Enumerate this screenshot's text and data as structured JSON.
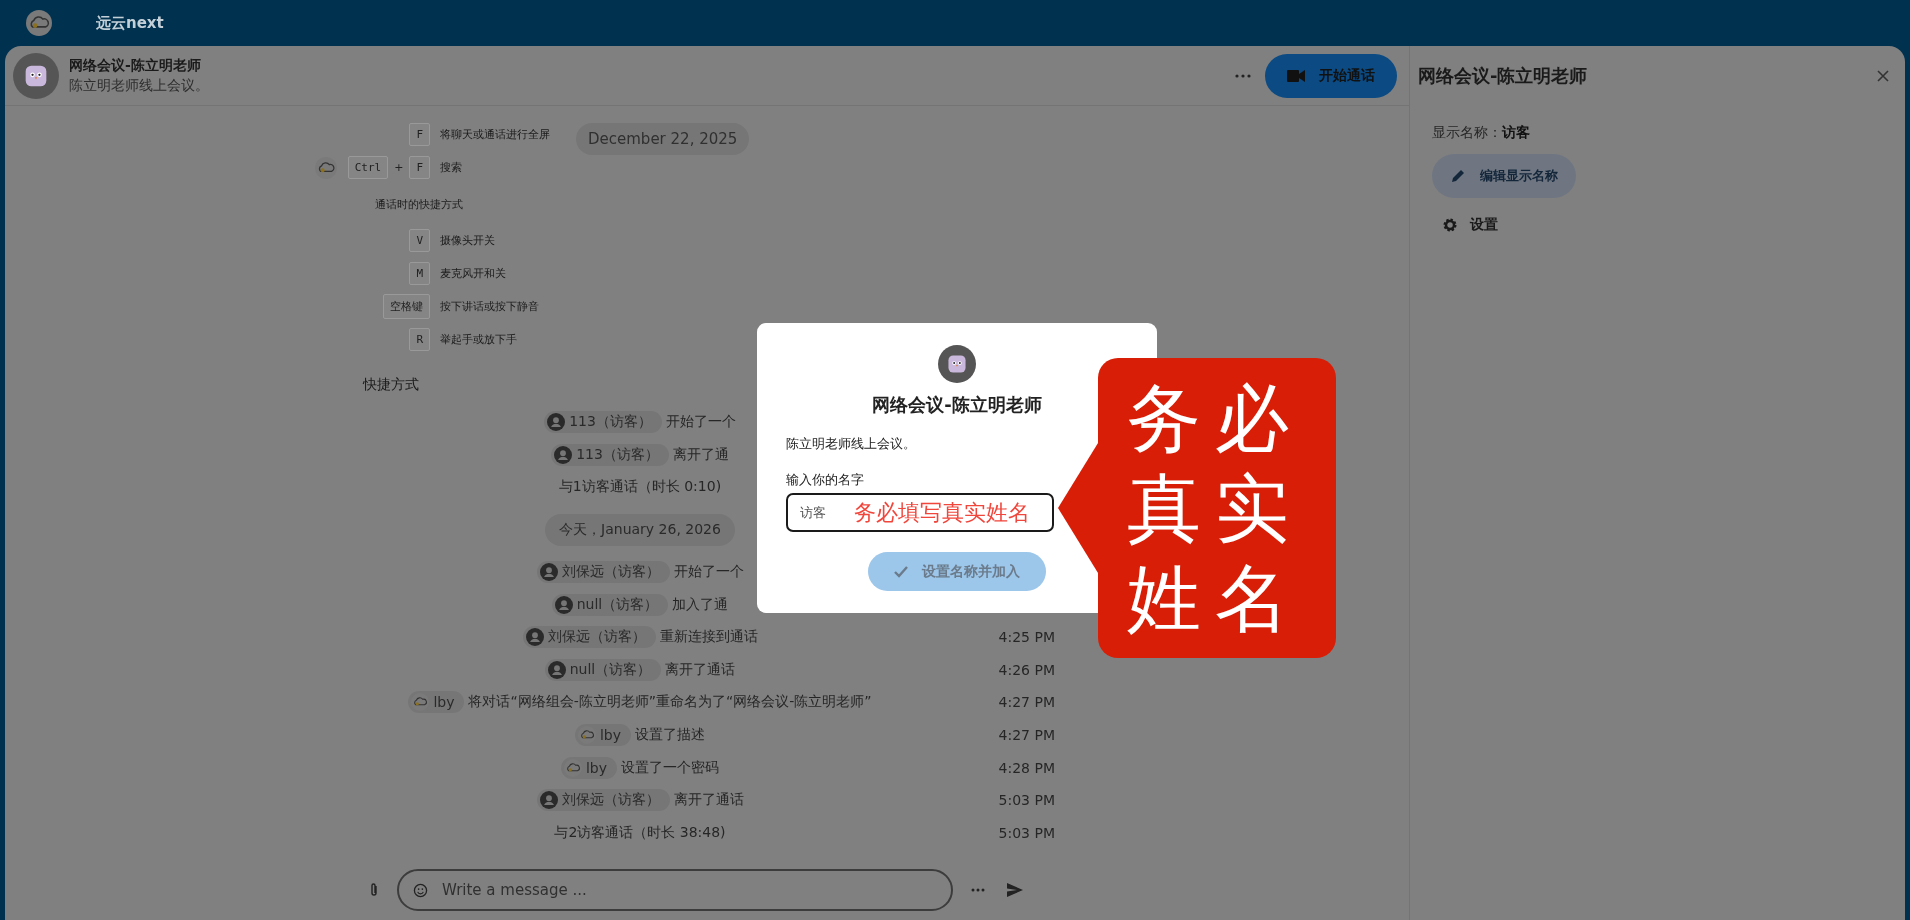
{
  "app": {
    "name": "远云next"
  },
  "conversation": {
    "title": "网络会议-陈立明老师",
    "description": "陈立明老师线上会议。",
    "start_call": "开始通话"
  },
  "shortcut_image": {
    "rows": [
      {
        "kind": "key",
        "keys": [
          "F"
        ],
        "text": "将聊天或通话进行全屏"
      },
      {
        "kind": "key",
        "keys": [
          "Ctrl",
          "F"
        ],
        "joiner": "+",
        "text": "搜索"
      },
      {
        "kind": "heading",
        "text": "通话时的快捷方式"
      },
      {
        "kind": "key",
        "keys": [
          "V"
        ],
        "text": "摄像头开关"
      },
      {
        "kind": "key",
        "keys": [
          "M"
        ],
        "text": "麦克风开和关"
      },
      {
        "kind": "key",
        "keys": [
          "空格键"
        ],
        "text": "按下讲话或按下静音"
      },
      {
        "kind": "key",
        "keys": [
          "R"
        ],
        "text": "举起手或放下手"
      }
    ]
  },
  "caption": "快捷方式",
  "sticky_date": "December 22, 2025",
  "messages": [
    {
      "kind": "event",
      "actor": {
        "name": "113（访客）",
        "kind": "person"
      },
      "text": "开始了一个"
    },
    {
      "kind": "event",
      "actor": {
        "name": "113（访客）",
        "kind": "person"
      },
      "text": "离开了通"
    },
    {
      "kind": "summary",
      "text": "与1访客通话（时长 0:10)"
    },
    {
      "kind": "date",
      "text": "今天，January 26, 2026"
    },
    {
      "kind": "event",
      "actor": {
        "name": "刘保远（访客）",
        "kind": "person"
      },
      "text": "开始了一个"
    },
    {
      "kind": "event",
      "actor": {
        "name": "null（访客）",
        "kind": "person"
      },
      "text": "加入了通"
    },
    {
      "kind": "event",
      "actor": {
        "name": "刘保远（访客）",
        "kind": "person"
      },
      "text": "重新连接到通话",
      "time": "4:25 PM"
    },
    {
      "kind": "event",
      "actor": {
        "name": "null（访客）",
        "kind": "person"
      },
      "text": "离开了通话",
      "time": "4:26 PM"
    },
    {
      "kind": "event",
      "actor": {
        "name": "lby",
        "kind": "logo"
      },
      "text": "将对话“网络组会-陈立明老师”重命名为了“网络会议-陈立明老师”",
      "time": "4:27 PM"
    },
    {
      "kind": "event",
      "actor": {
        "name": "lby",
        "kind": "logo"
      },
      "text": "设置了描述",
      "time": "4:27 PM"
    },
    {
      "kind": "event",
      "actor": {
        "name": "lby",
        "kind": "logo"
      },
      "text": "设置了一个密码",
      "time": "4:28 PM"
    },
    {
      "kind": "event",
      "actor": {
        "name": "刘保远（访客）",
        "kind": "person"
      },
      "text": "离开了通话",
      "time": "5:03 PM"
    },
    {
      "kind": "summary",
      "text": "与2访客通话（时长 38:48)",
      "time": "5:03 PM"
    }
  ],
  "composer": {
    "placeholder": "Write a message ..."
  },
  "sidebar": {
    "title": "网络会议-陈立明老师",
    "display_name_label": "显示名称：",
    "display_name": "访客",
    "edit_button": "编辑显示名称",
    "settings": "设置"
  },
  "dialog": {
    "title": "网络会议-陈立明老师",
    "description": "陈立明老师线上会议。",
    "field_label": "输入你的名字",
    "value": "访客",
    "hint": "务必填写真实姓名",
    "button": {
      "label": "设置名称并加入",
      "disabled": true
    }
  },
  "annotation": {
    "text": "务必真实姓名"
  }
}
